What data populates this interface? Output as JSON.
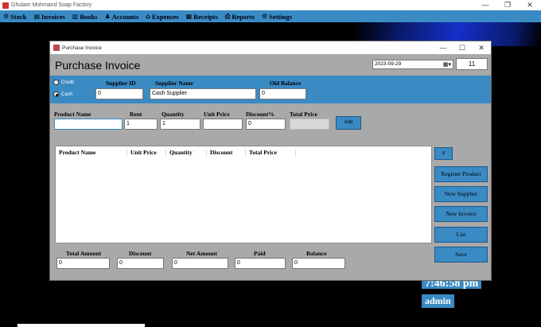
{
  "app": {
    "title": "Ghulam Mohmand Soap Factory",
    "controls": [
      "—",
      "❐",
      "✕"
    ]
  },
  "menu": [
    {
      "label": "Stock",
      "icon": "gear-icon",
      "glyph": "⚙"
    },
    {
      "label": "Invoices",
      "icon": "document-icon",
      "glyph": "▤"
    },
    {
      "label": "Books",
      "icon": "books-icon",
      "glyph": "▥"
    },
    {
      "label": "Accounts",
      "icon": "users-icon",
      "glyph": "♟"
    },
    {
      "label": "Expenses",
      "icon": "bank-icon",
      "glyph": "⌂"
    },
    {
      "label": "Receipts",
      "icon": "receipt-icon",
      "glyph": "▦"
    },
    {
      "label": "Reports",
      "icon": "print-icon",
      "glyph": "⎙"
    },
    {
      "label": "Settings",
      "icon": "gear-icon",
      "glyph": "⚙"
    }
  ],
  "desktop": {
    "clock": "7:46:58 pm",
    "user": "admin"
  },
  "window": {
    "title": "Purchase Invoice",
    "controls": [
      "—",
      "☐",
      "✕"
    ],
    "heading": "Purchase Invoice",
    "date": "2023-09-29",
    "invoice_no": "11"
  },
  "supplier": {
    "radio_credit": "Credit",
    "radio_cash": "Cash",
    "selected": "cash",
    "id_label": "Supplier ID",
    "id_value": "0",
    "name_label": "Supplier Name",
    "name_value": "Cash Supplier",
    "balance_label": "Old Balance",
    "balance_value": "0"
  },
  "product": {
    "name_label": "Product Name",
    "name_value": "",
    "rent_label": "Rent",
    "rent_value": "1",
    "qty_label": "Quantity",
    "qty_value": "1",
    "unit_label": "Unit Price",
    "unit_value": "",
    "disc_label": "Discount%",
    "disc_value": "0",
    "total_label": "Total Price",
    "total_value": "",
    "add_label": "Add"
  },
  "grid": {
    "columns": [
      "Product Name",
      "Unit Price",
      "Quantity",
      "Discount",
      "Total Price"
    ],
    "rows": []
  },
  "actions": {
    "x": "X",
    "register": "Register Product",
    "new_supplier": "New Supplier",
    "new_invoice": "New Invoice",
    "list": "List",
    "save": "Save"
  },
  "totals": {
    "total_label": "Total Amount",
    "total_value": "0",
    "discount_label": "Discount",
    "discount_value": "0",
    "net_label": "Net Amount",
    "net_value": "0",
    "paid_label": "Paid",
    "paid_value": "0",
    "balance_label": "Balance",
    "balance_value": "0"
  }
}
